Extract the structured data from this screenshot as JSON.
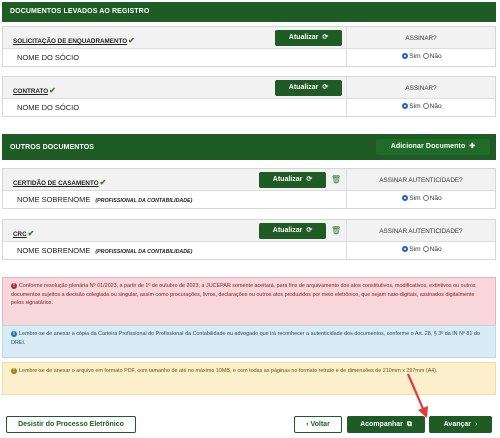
{
  "sections": {
    "docs_registro": "DOCUMENTOS LEVADOS AO REGISTRO",
    "outros_docs": "OUTROS DOCUMENTOS"
  },
  "labels": {
    "atualizar": "Atualizar",
    "adicionar": "Adicionar Documento",
    "sim": "Sim",
    "nao": "Não",
    "assinar": "ASSINAR?",
    "assinar_aut": "ASSINAR AUTENTICIDADE?"
  },
  "docs": [
    {
      "title": "SOLICITAÇÃO DE ENQUADRAMENTO",
      "name": "NOME DO SÓCIO",
      "role": "",
      "assinar": "sim"
    },
    {
      "title": "CONTRATO",
      "name": "NOME DO SÓCIO",
      "role": "",
      "assinar": "sim"
    }
  ],
  "outros": [
    {
      "title": "CERTIDÃO DE CASAMENTO",
      "name": "NOME SOBRENOME",
      "role": "(PROFISSIONAL DA CONTABILIDADE)",
      "assinar": "sim"
    },
    {
      "title": "CRC",
      "name": "NOME SOBRENOME",
      "role": "(PROFISSIONAL DA CONTABILIDADE)",
      "assinar": "sim"
    }
  ],
  "alerts": {
    "red": "Conforme resolução plenária Nº 01/2023, a partir de 1º de outubro de 2023, a JUCEPAR somente aceitará, para fins de arquivamento dos atos constitutivos, modificativos, extintivos ou outros documentos sujeitos a decisão colegiada ou singular, assim como procurações, livros, declarações ou outros atos produzidos por meio eletrônico, que sejam nato-digitais, assinados digitalmente pelos signatários.",
    "blue": "Lembre-se de anexar a cópia da Carteira Profissional do Profissional da Contabilidade ou advogado que irá reconhecer a autenticidade dos documentos, conforme o Art. 28, § 3º da IN Nº 81 do DREI.",
    "yellow": "Lembre-se de anexar o arquivo em formato PDF, com tamanho de até no máximo 10MB, e com todas as páginas no formato retrato e de dimensões de 210mm x 297mm (A4)."
  },
  "footer": {
    "desistir": "Desistir do Processo Eletrônico",
    "voltar": "Voltar",
    "acompanhar": "Acompanhar",
    "avancar": "Avançar"
  },
  "colors": {
    "primary_green": "#1f5b25",
    "annotation_arrow": "#e53935"
  }
}
